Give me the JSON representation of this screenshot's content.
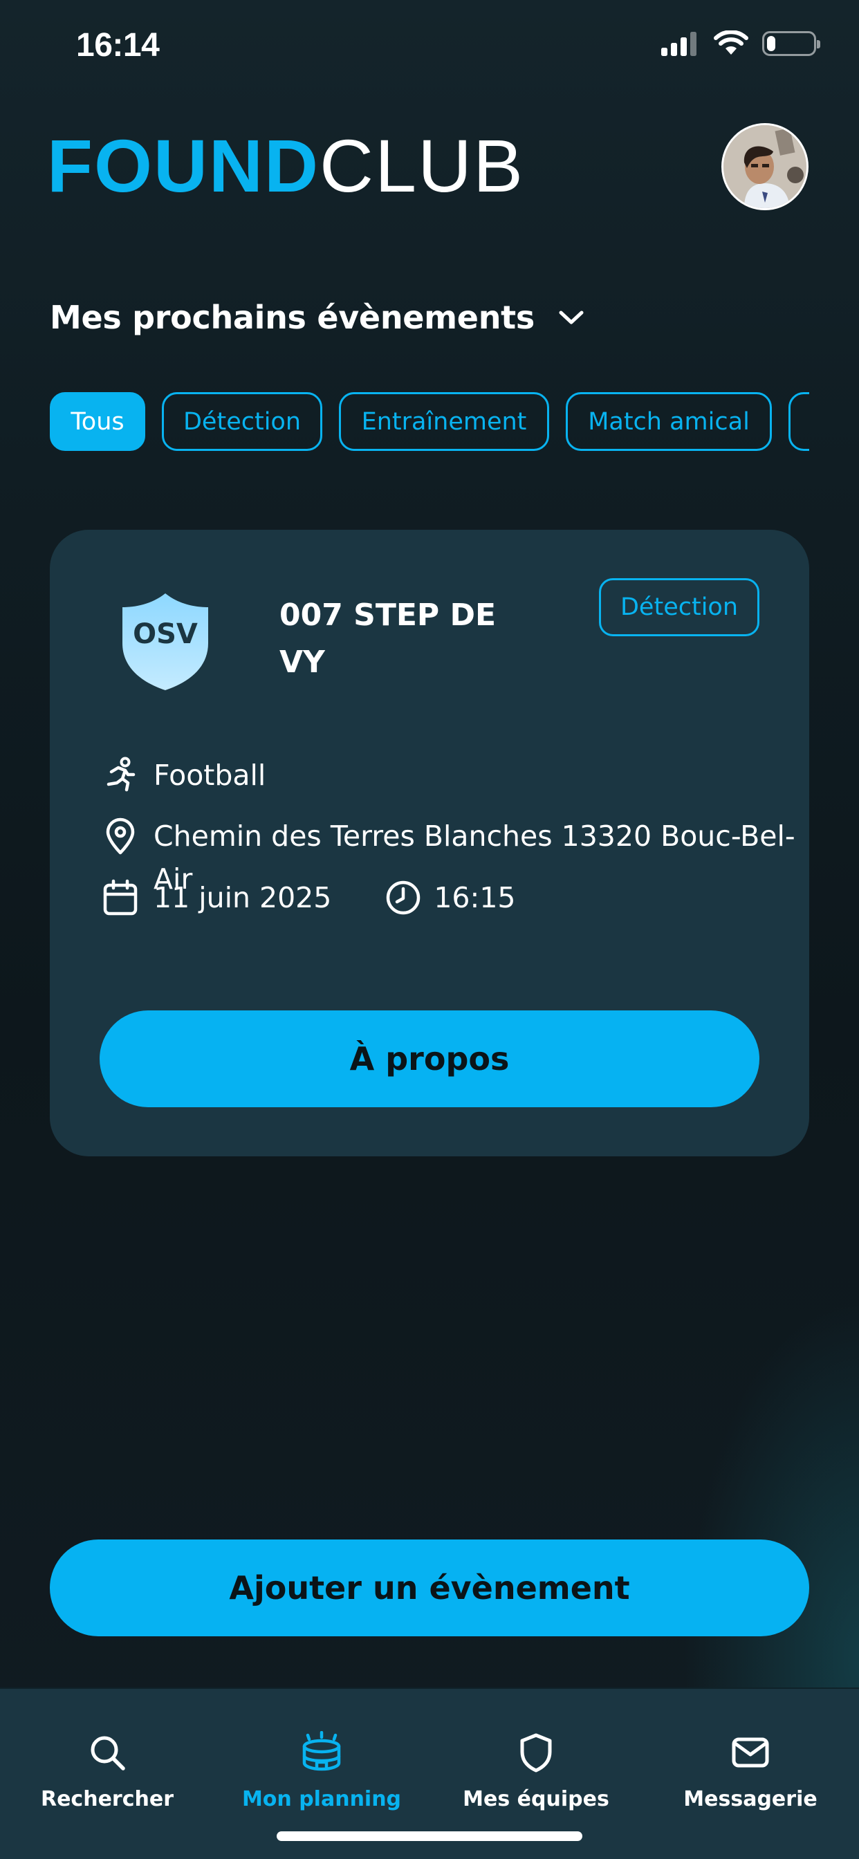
{
  "status_bar": {
    "time": "16:14",
    "icons": [
      "signal-icon",
      "wifi-icon",
      "battery-icon"
    ],
    "battery_level": 0.18
  },
  "header": {
    "logo_part1": "FOUND",
    "logo_part2": "CLUB",
    "avatar_icon": "user-avatar"
  },
  "section": {
    "title": "Mes prochains évènements",
    "chevron_icon": "chevron-down-icon"
  },
  "filters": {
    "items": [
      {
        "label": "Tous",
        "active": true
      },
      {
        "label": "Détection",
        "active": false
      },
      {
        "label": "Entraînement",
        "active": false
      },
      {
        "label": "Match amical",
        "active": false
      },
      {
        "label": "",
        "active": false
      }
    ]
  },
  "event": {
    "club_badge": "OSV",
    "title": "007 STEP DE VY",
    "type_badge": "Détection",
    "sport": "Football",
    "location": "Chemin des Terres Blanches 13320 Bouc-Bel-Air",
    "date": "11 juin 2025",
    "time": "16:15",
    "about_button": "À propos",
    "icons": [
      "running-icon",
      "location-pin-icon",
      "calendar-icon",
      "clock-icon"
    ]
  },
  "add_button": "Ajouter un évènement",
  "tabbar": {
    "items": [
      {
        "label": "Rechercher",
        "icon": "search-icon",
        "active": false
      },
      {
        "label": "Mon planning",
        "icon": "stadium-icon",
        "active": true
      },
      {
        "label": "Mes équipes",
        "icon": "shield-icon",
        "active": false
      },
      {
        "label": "Messagerie",
        "icon": "mail-icon",
        "active": false
      }
    ]
  },
  "colors": {
    "accent": "#08b3f0",
    "background": "#0f1a1f",
    "card": "#1b3642",
    "button_text": "#0b1418",
    "text": "#ffffff"
  }
}
